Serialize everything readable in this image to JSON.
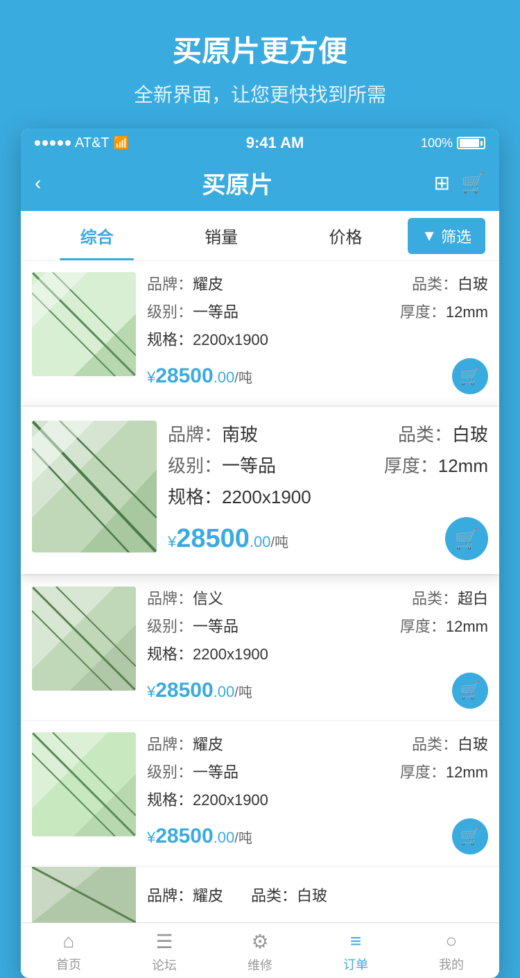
{
  "promo": {
    "title": "买原片更方便",
    "subtitle": "全新界面，让您更快找到所需"
  },
  "statusBar": {
    "carrier": "AT&T",
    "time": "9:41 AM",
    "battery": "100%"
  },
  "navbar": {
    "title": "买原片",
    "back": "‹"
  },
  "sortBar": {
    "items": [
      "综合",
      "销量",
      "价格"
    ],
    "activeIndex": 0,
    "filterLabel": "筛选"
  },
  "products": [
    {
      "brand_label": "品牌：",
      "brand_value": "耀皮",
      "category_label": "品类：",
      "category_value": "白玻",
      "grade_label": "级别：",
      "grade_value": "一等品",
      "thickness_label": "厚度：",
      "thickness_value": "12mm",
      "spec_label": "规格：",
      "spec_value": "2200x1900",
      "price_symbol": "¥",
      "price_main": "28500",
      "price_decimal": ".00",
      "price_unit": "/吨",
      "highlighted": false
    },
    {
      "brand_label": "品牌：",
      "brand_value": "南玻",
      "category_label": "品类：",
      "category_value": "白玻",
      "grade_label": "级别：",
      "grade_value": "一等品",
      "thickness_label": "厚度：",
      "thickness_value": "12mm",
      "spec_label": "规格：",
      "spec_value": "2200x1900",
      "price_symbol": "¥",
      "price_main": "28500",
      "price_decimal": ".00",
      "price_unit": "/吨",
      "highlighted": true
    },
    {
      "brand_label": "品牌：",
      "brand_value": "信义",
      "category_label": "品类：",
      "category_value": "超白",
      "grade_label": "级别：",
      "grade_value": "一等品",
      "thickness_label": "厚度：",
      "thickness_value": "12mm",
      "spec_label": "规格：",
      "spec_value": "2200x1900",
      "price_symbol": "¥",
      "price_main": "28500",
      "price_decimal": ".00",
      "price_unit": "/吨",
      "highlighted": false
    },
    {
      "brand_label": "品牌：",
      "brand_value": "耀皮",
      "category_label": "品类：",
      "category_value": "白玻",
      "grade_label": "级别：",
      "grade_value": "一等品",
      "thickness_label": "厚度：",
      "thickness_value": "12mm",
      "spec_label": "规格：",
      "spec_value": "2200x1900",
      "price_symbol": "¥",
      "price_main": "28500",
      "price_decimal": ".00",
      "price_unit": "/吨",
      "highlighted": false
    }
  ],
  "partialProduct": {
    "brand_label": "品牌：",
    "brand_value": "耀皮",
    "category_label": "品类：",
    "category_value": "白玻"
  },
  "tabs": [
    {
      "icon": "home",
      "label": "首页",
      "active": false
    },
    {
      "icon": "forum",
      "label": "论坛",
      "active": false
    },
    {
      "icon": "repair",
      "label": "维修",
      "active": false
    },
    {
      "icon": "order",
      "label": "订单",
      "active": true
    },
    {
      "icon": "mine",
      "label": "我的",
      "active": false
    }
  ]
}
